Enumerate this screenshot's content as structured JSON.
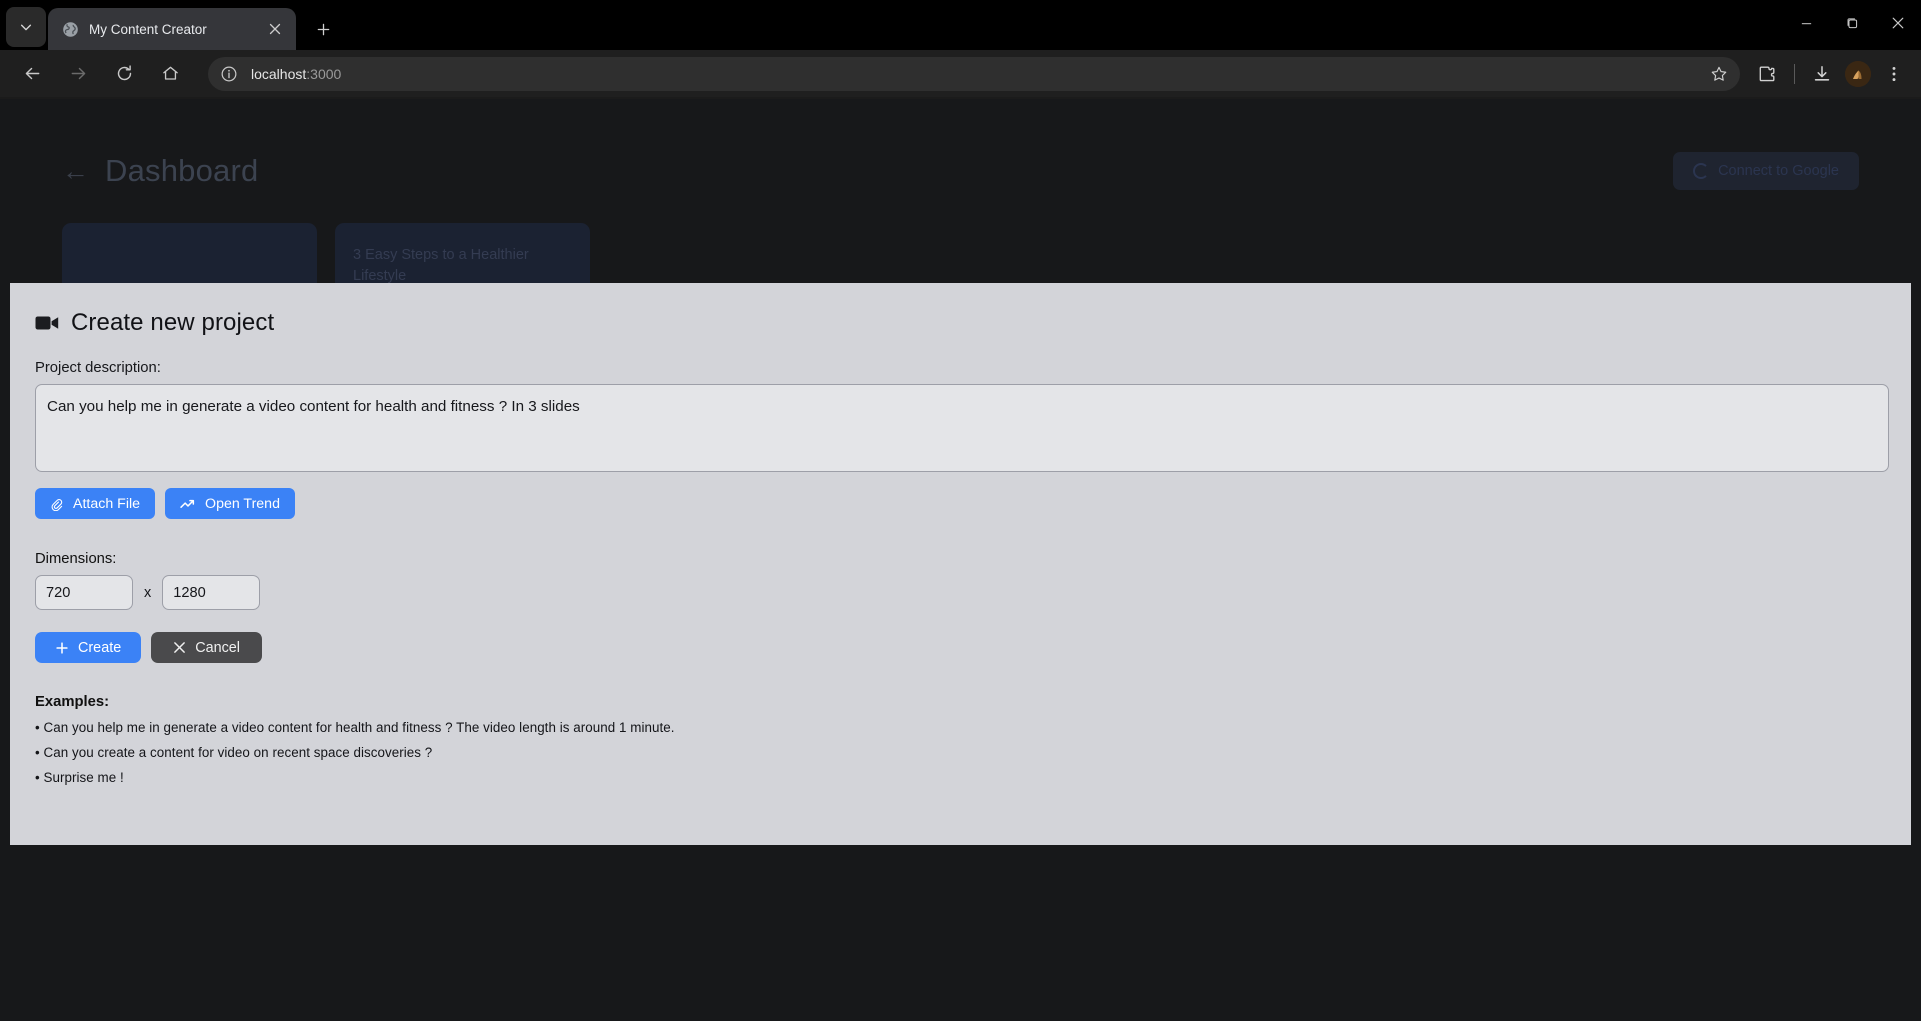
{
  "browser": {
    "tab": {
      "title": "My Content Creator",
      "favicon": "globe-icon",
      "close_label": "✕"
    },
    "new_tab_label": "+",
    "tab_list_label": "⌄",
    "nav": {
      "back_label": "←",
      "forward_label": "→",
      "reload_label": "↻",
      "home_label": "⌂"
    },
    "omnibox": {
      "url_host": "localhost",
      "url_port": ":3000",
      "site_info_icon": "info-circle-icon",
      "bookmark_icon": "star-icon"
    },
    "toolbar_icons": {
      "extensions": "puzzle-piece-icon",
      "downloads": "download-icon",
      "profile": "avatar-icon",
      "menu": "three-dot-menu-icon"
    },
    "window_controls": {
      "minimize": "—",
      "maximize": "❐",
      "close": "✕"
    }
  },
  "app": {
    "back_label": "←",
    "title": "Dashboard",
    "connect_button": "Connect to Google",
    "cards": [
      {
        "title": ""
      },
      {
        "title": "3 Easy Steps to a Healthier Lifestyle"
      }
    ]
  },
  "modal": {
    "title": "Create new project",
    "title_icon": "video-camera-icon",
    "description_label": "Project description:",
    "description_value": "Can you help me in generate a video content for health and fitness ? In 3 slides",
    "attach_button": "Attach File",
    "attach_icon": "paperclip-icon",
    "trend_button": "Open Trend",
    "trend_icon": "trending-up-icon",
    "dimensions_label": "Dimensions:",
    "width_value": "720",
    "height_value": "1280",
    "dimensions_separator": "x",
    "create_button": "Create",
    "create_icon": "plus-icon",
    "cancel_button": "Cancel",
    "cancel_icon": "close-x-icon",
    "examples_label": "Examples:",
    "examples": [
      "• Can you help me in generate a video content for health and fitness ? The video length is around 1 minute.",
      "• Can you create a content for video on recent space discoveries ?",
      "• Surprise me !"
    ]
  },
  "colors": {
    "accent_blue": "#3b82f6",
    "modal_bg": "#d3d4d9",
    "cancel_gray": "#4a4a4c",
    "page_bg": "#17181a"
  }
}
